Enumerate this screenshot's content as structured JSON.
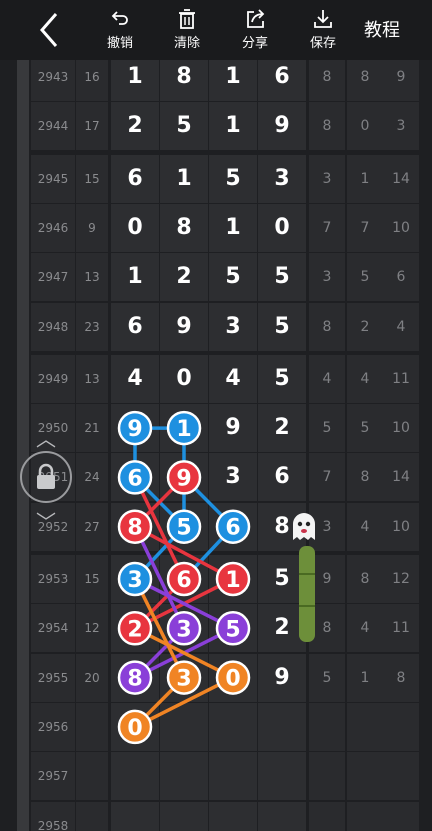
{
  "toolbar": {
    "back_icon": "chevron-left-icon",
    "undo_label": "撤销",
    "clear_label": "清除",
    "share_label": "分享",
    "save_label": "保存",
    "tutorial_label": "教程"
  },
  "rows": [
    {
      "issue": "2943",
      "sum": "16",
      "d": [
        "1",
        "8",
        "1",
        "6"
      ],
      "s": [
        "8",
        "8",
        "9"
      ]
    },
    {
      "issue": "2944",
      "sum": "17",
      "d": [
        "2",
        "5",
        "1",
        "9"
      ],
      "s": [
        "8",
        "0",
        "3"
      ]
    },
    {
      "issue": "2945",
      "sum": "15",
      "d": [
        "6",
        "1",
        "5",
        "3"
      ],
      "s": [
        "3",
        "1",
        "14"
      ]
    },
    {
      "issue": "2946",
      "sum": "9",
      "d": [
        "0",
        "8",
        "1",
        "0"
      ],
      "s": [
        "7",
        "7",
        "10"
      ]
    },
    {
      "issue": "2947",
      "sum": "13",
      "d": [
        "1",
        "2",
        "5",
        "5"
      ],
      "s": [
        "3",
        "5",
        "6"
      ]
    },
    {
      "issue": "2948",
      "sum": "23",
      "d": [
        "6",
        "9",
        "3",
        "5"
      ],
      "s": [
        "8",
        "2",
        "4"
      ]
    },
    {
      "issue": "2949",
      "sum": "13",
      "d": [
        "4",
        "0",
        "4",
        "5"
      ],
      "s": [
        "4",
        "4",
        "11"
      ]
    },
    {
      "issue": "2950",
      "sum": "21",
      "d": [
        "9",
        "1",
        "9",
        "2"
      ],
      "s": [
        "5",
        "5",
        "10"
      ]
    },
    {
      "issue": "2951",
      "sum": "24",
      "d": [
        "6",
        "9",
        "3",
        "6"
      ],
      "s": [
        "7",
        "8",
        "14"
      ]
    },
    {
      "issue": "2952",
      "sum": "27",
      "d": [
        "8",
        "5",
        "6",
        "8"
      ],
      "s": [
        "3",
        "4",
        "10"
      ]
    },
    {
      "issue": "2953",
      "sum": "15",
      "d": [
        "3",
        "6",
        "1",
        "5"
      ],
      "s": [
        "9",
        "8",
        "12"
      ]
    },
    {
      "issue": "2954",
      "sum": "12",
      "d": [
        "2",
        "3",
        "5",
        "2"
      ],
      "s": [
        "8",
        "4",
        "11"
      ]
    },
    {
      "issue": "2955",
      "sum": "20",
      "d": [
        "8",
        "3",
        "0",
        "9"
      ],
      "s": [
        "5",
        "1",
        "8"
      ]
    },
    {
      "issue": "2956",
      "sum": "",
      "d": [
        "",
        "",
        "",
        ""
      ],
      "s": [
        "",
        "",
        ""
      ]
    },
    {
      "issue": "2957",
      "sum": "",
      "d": [
        "",
        "",
        "",
        ""
      ],
      "s": [
        "",
        "",
        ""
      ]
    },
    {
      "issue": "2958",
      "sum": "",
      "d": [
        "",
        "",
        "",
        ""
      ],
      "s": [
        "",
        "",
        ""
      ]
    }
  ],
  "markers": [
    {
      "row": 7,
      "col": 0,
      "color": "#1e90e0",
      "label": "9"
    },
    {
      "row": 7,
      "col": 1,
      "color": "#1e90e0",
      "label": "1"
    },
    {
      "row": 8,
      "col": 0,
      "color": "#1e90e0",
      "label": "6"
    },
    {
      "row": 8,
      "col": 1,
      "color": "#e8353f",
      "label": "9"
    },
    {
      "row": 9,
      "col": 0,
      "color": "#e8353f",
      "label": "8"
    },
    {
      "row": 9,
      "col": 1,
      "color": "#1e90e0",
      "label": "5"
    },
    {
      "row": 9,
      "col": 2,
      "color": "#1e90e0",
      "label": "6"
    },
    {
      "row": 10,
      "col": 0,
      "color": "#1e90e0",
      "label": "3"
    },
    {
      "row": 10,
      "col": 1,
      "color": "#e8353f",
      "label": "6"
    },
    {
      "row": 10,
      "col": 2,
      "color": "#e8353f",
      "label": "1"
    },
    {
      "row": 11,
      "col": 0,
      "color": "#e8353f",
      "label": "2"
    },
    {
      "row": 11,
      "col": 1,
      "color": "#8a3fd8",
      "label": "3"
    },
    {
      "row": 11,
      "col": 2,
      "color": "#8a3fd8",
      "label": "5"
    },
    {
      "row": 12,
      "col": 0,
      "color": "#8a3fd8",
      "label": "8"
    },
    {
      "row": 12,
      "col": 1,
      "color": "#f08424",
      "label": "3"
    },
    {
      "row": 12,
      "col": 2,
      "color": "#f08424",
      "label": "0"
    },
    {
      "row": 13,
      "col": 0,
      "color": "#f08424",
      "label": "0"
    }
  ],
  "lines": [
    {
      "color": "#1e90e0",
      "pts": [
        [
          7,
          0
        ],
        [
          7,
          1
        ]
      ]
    },
    {
      "color": "#1e90e0",
      "pts": [
        [
          7,
          0
        ],
        [
          8,
          0
        ]
      ]
    },
    {
      "color": "#1e90e0",
      "pts": [
        [
          8,
          0
        ],
        [
          9,
          1
        ]
      ]
    },
    {
      "color": "#1e90e0",
      "pts": [
        [
          7,
          1
        ],
        [
          9,
          1
        ]
      ]
    },
    {
      "color": "#1e90e0",
      "pts": [
        [
          9,
          1
        ],
        [
          10,
          0
        ]
      ]
    },
    {
      "color": "#1e90e0",
      "pts": [
        [
          8,
          1
        ],
        [
          9,
          2
        ]
      ]
    },
    {
      "color": "#1e90e0",
      "pts": [
        [
          9,
          2
        ],
        [
          10,
          1
        ]
      ]
    },
    {
      "color": "#e8353f",
      "pts": [
        [
          8,
          1
        ],
        [
          9,
          0
        ]
      ]
    },
    {
      "color": "#e8353f",
      "pts": [
        [
          9,
          0
        ],
        [
          10,
          2
        ]
      ]
    },
    {
      "color": "#e8353f",
      "pts": [
        [
          8,
          0
        ],
        [
          10,
          1
        ]
      ]
    },
    {
      "color": "#e8353f",
      "pts": [
        [
          10,
          1
        ],
        [
          11,
          0
        ]
      ]
    },
    {
      "color": "#e8353f",
      "pts": [
        [
          10,
          2
        ],
        [
          11,
          0
        ]
      ]
    },
    {
      "color": "#8a3fd8",
      "pts": [
        [
          9,
          0
        ],
        [
          11,
          1
        ]
      ]
    },
    {
      "color": "#8a3fd8",
      "pts": [
        [
          10,
          0
        ],
        [
          11,
          2
        ]
      ]
    },
    {
      "color": "#8a3fd8",
      "pts": [
        [
          11,
          1
        ],
        [
          12,
          0
        ]
      ]
    },
    {
      "color": "#8a3fd8",
      "pts": [
        [
          11,
          2
        ],
        [
          12,
          0
        ]
      ]
    },
    {
      "color": "#f08424",
      "pts": [
        [
          10,
          0
        ],
        [
          12,
          1
        ]
      ]
    },
    {
      "color": "#f08424",
      "pts": [
        [
          11,
          0
        ],
        [
          12,
          2
        ]
      ]
    },
    {
      "color": "#f08424",
      "pts": [
        [
          12,
          1
        ],
        [
          13,
          0
        ]
      ]
    },
    {
      "color": "#f08424",
      "pts": [
        [
          12,
          2
        ],
        [
          13,
          0
        ]
      ]
    }
  ],
  "lock_icon": "lock-icon",
  "ghost_icon": "ghost-icon",
  "scroll_up_icon": "chevron-up-icon",
  "scroll_down_icon": "chevron-down-icon"
}
